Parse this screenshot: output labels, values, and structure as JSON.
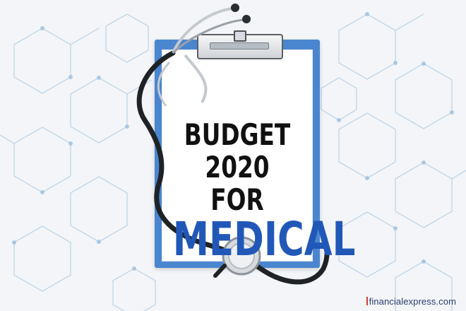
{
  "headline": {
    "line1": "BUDGET 2020",
    "line2": "FOR",
    "line3": "MEDICAL"
  },
  "watermark": {
    "text": "financialexpress.com"
  },
  "colors": {
    "background": "#f3f5f8",
    "pattern": "#a9c7e3",
    "clipboard": "#4a86cf",
    "headline_dark": "#111111",
    "headline_accent": "#2158b8",
    "stethoscope_tube": "#1f2326",
    "stethoscope_metal": "#c4c9ce"
  },
  "icons": [
    "stethoscope-icon",
    "clipboard-icon"
  ]
}
